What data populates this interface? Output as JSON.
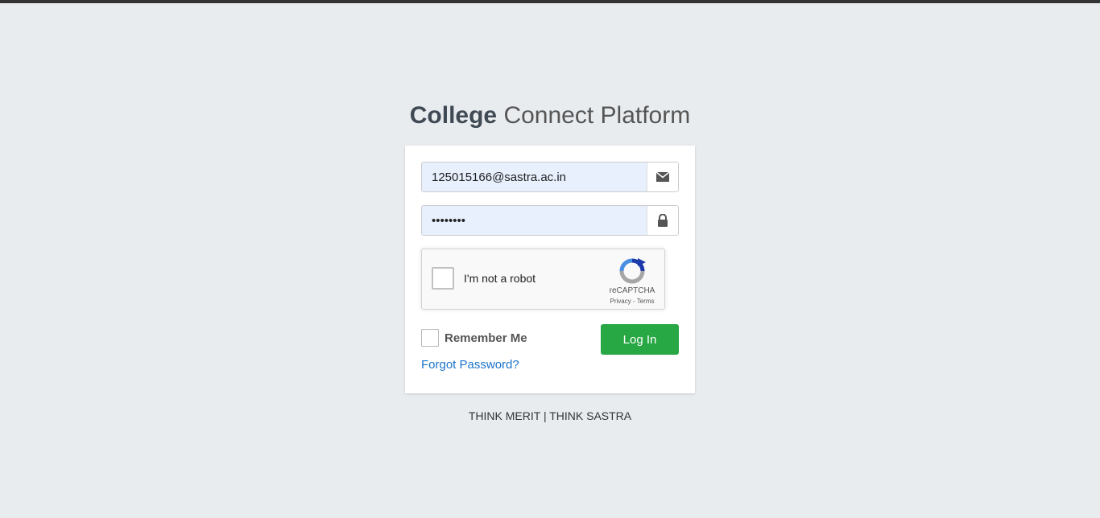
{
  "header": {
    "title_bold": "College",
    "title_light": "Connect Platform"
  },
  "login_form": {
    "email_value": "125015166@sastra.ac.in",
    "email_icon": "envelope-icon",
    "password_value": "••••••••",
    "password_icon": "lock-icon",
    "recaptcha": {
      "label": "I'm not a robot",
      "brand": "reCAPTCHA",
      "privacy": "Privacy",
      "separator": " - ",
      "terms": "Terms"
    },
    "remember_label": "Remember Me",
    "remember_checked": false,
    "login_label": "Log In",
    "forgot_label": "Forgot Password?"
  },
  "footer": {
    "tagline": "THINK MERIT | THINK SASTRA"
  },
  "colors": {
    "background": "#e9ecef",
    "login_button": "#28a745",
    "link": "#1a73c9",
    "autofill": "#e8f0fe"
  }
}
